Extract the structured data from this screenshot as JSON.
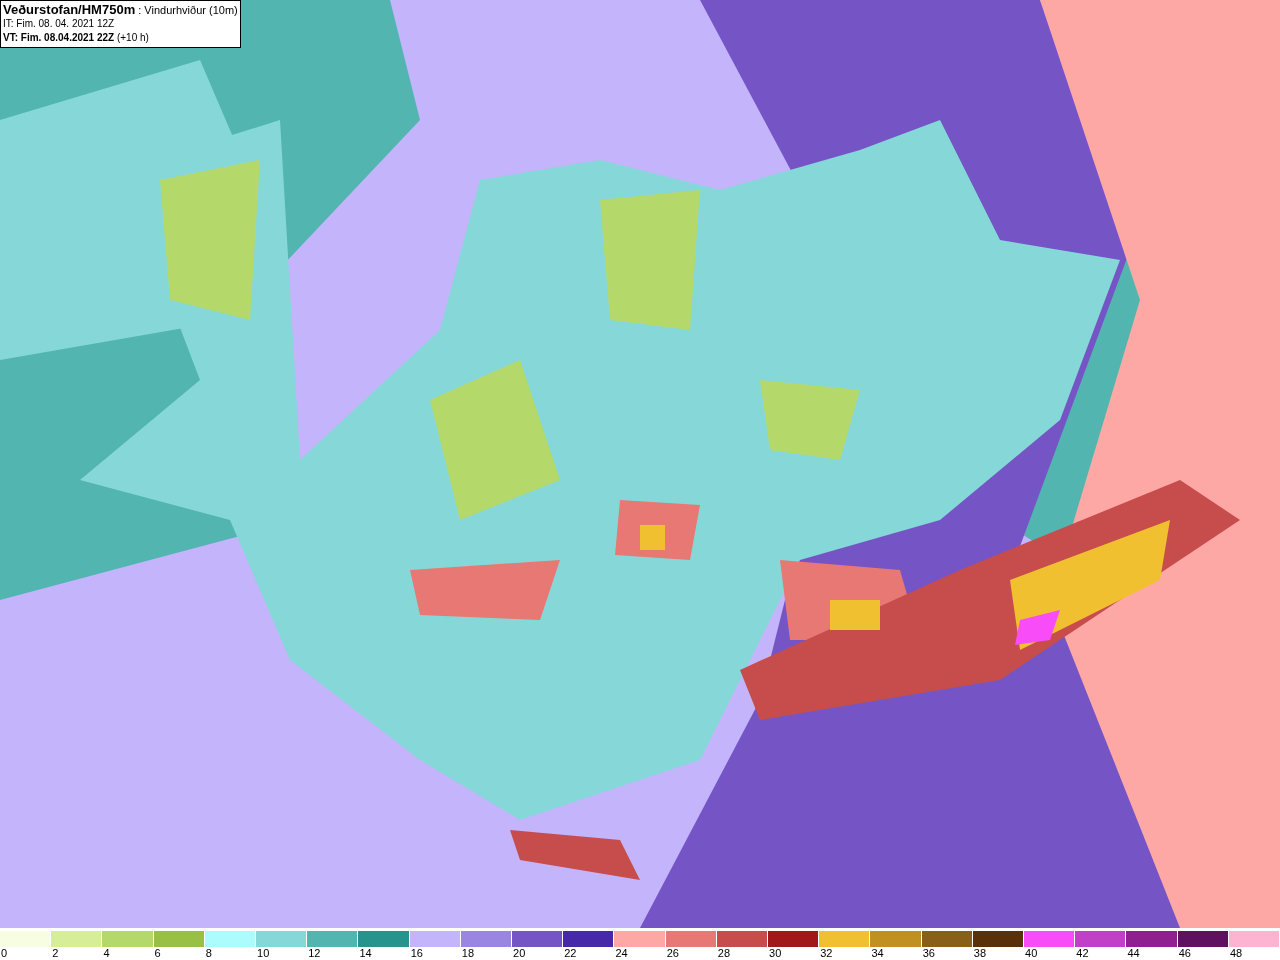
{
  "map": {
    "title": "**Veðurstofan/HM750m** : Vindurhviður (10m)",
    "init_time": "IT: Fim. 08. 04. 2021 12Z",
    "valid_time": "**VT: Fim. 08.04.2021 22Z** (+10 h)"
  },
  "legend": {
    "bins": [
      {
        "label": "0",
        "color": "#f7fde0"
      },
      {
        "label": "2",
        "color": "#d6ee98"
      },
      {
        "label": "4",
        "color": "#b4d96a"
      },
      {
        "label": "6",
        "color": "#98c044"
      },
      {
        "label": "8",
        "color": "#acfcfd"
      },
      {
        "label": "10",
        "color": "#86d8d8"
      },
      {
        "label": "12",
        "color": "#52b5b0"
      },
      {
        "label": "14",
        "color": "#27938d"
      },
      {
        "label": "16",
        "color": "#c3b4fb"
      },
      {
        "label": "18",
        "color": "#9a86e2"
      },
      {
        "label": "20",
        "color": "#7555c6"
      },
      {
        "label": "22",
        "color": "#4628a8"
      },
      {
        "label": "24",
        "color": "#fea8a6"
      },
      {
        "label": "26",
        "color": "#e87874"
      },
      {
        "label": "28",
        "color": "#c74c4c"
      },
      {
        "label": "30",
        "color": "#a01818"
      },
      {
        "label": "32",
        "color": "#f0c030"
      },
      {
        "label": "34",
        "color": "#c09020"
      },
      {
        "label": "36",
        "color": "#8a6018"
      },
      {
        "label": "38",
        "color": "#5a3008"
      },
      {
        "label": "40",
        "color": "#f84cf8"
      },
      {
        "label": "42",
        "color": "#c040c8"
      },
      {
        "label": "44",
        "color": "#902090"
      },
      {
        "label": "46",
        "color": "#601060"
      },
      {
        "label": "48",
        "color": "#fcb4d0"
      }
    ]
  }
}
